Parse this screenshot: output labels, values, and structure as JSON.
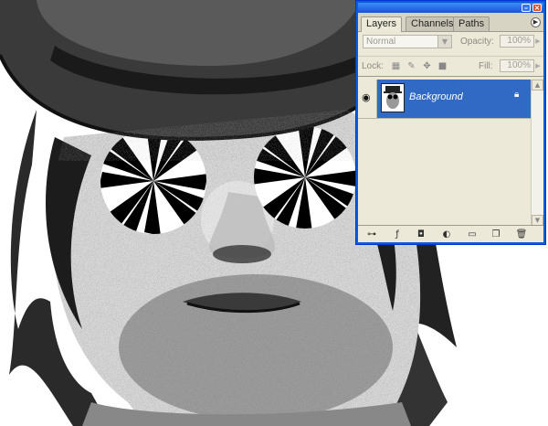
{
  "palette": {
    "tabs": [
      "Layers",
      "Channels",
      "Paths"
    ],
    "blend_mode": "Normal",
    "opacity_label": "Opacity:",
    "opacity_value": "100%",
    "lock_label": "Lock:",
    "fill_label": "Fill:",
    "fill_value": "100%",
    "layers": [
      {
        "name": "Background",
        "visible": true,
        "locked": true,
        "selected": true
      }
    ]
  },
  "colors": {
    "selection": "#316ac5",
    "panel_bg": "#ece9d8",
    "titlebar": "#2466e0"
  },
  "icons": {
    "layer_visibility": "eye-icon",
    "layer_lock": "lock-icon",
    "bottom_bar": [
      "link-layers-icon",
      "layer-style-icon",
      "layer-mask-icon",
      "adjustment-layer-icon",
      "new-group-icon",
      "new-layer-icon",
      "delete-layer-icon"
    ]
  }
}
